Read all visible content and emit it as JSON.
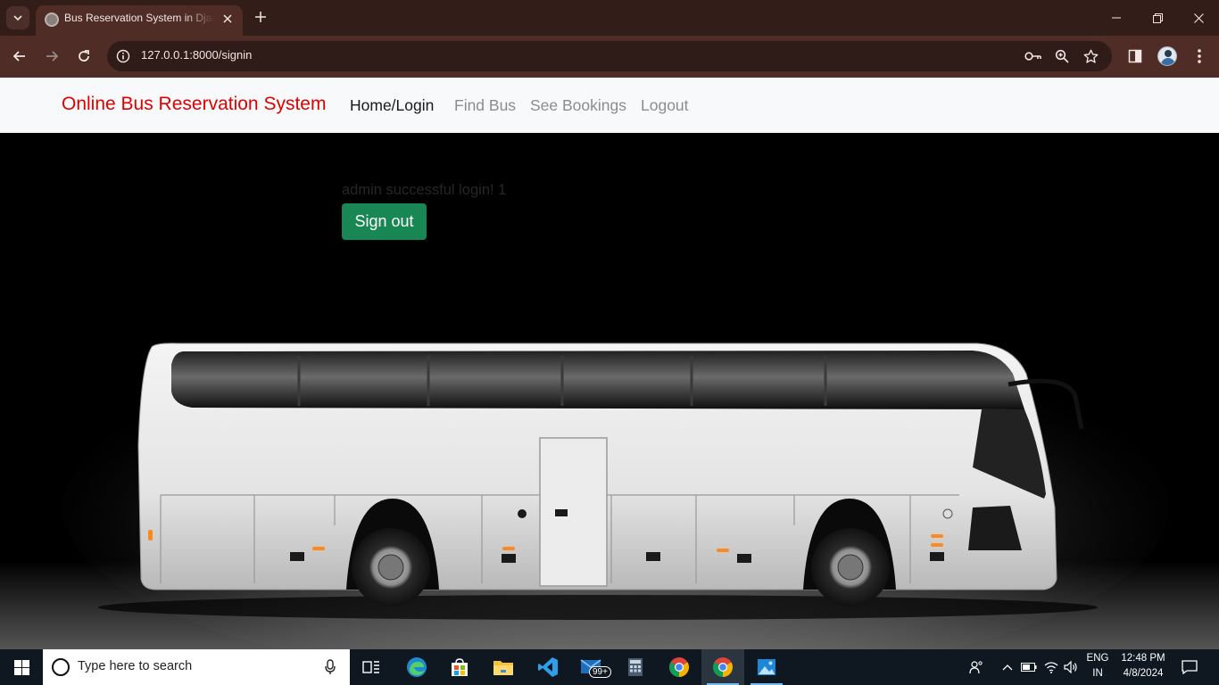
{
  "browser": {
    "tab_title": "Bus Reservation System in Django",
    "url": "127.0.0.1:8000/signin"
  },
  "navbar": {
    "brand": "Online Bus Reservation System",
    "links": [
      "Home/Login",
      "Find Bus",
      "See Bookings",
      "Logout"
    ],
    "active_index": 0
  },
  "content": {
    "message": "admin successful login! 1",
    "signout_label": "Sign out"
  },
  "taskbar": {
    "search_placeholder": "Type here to search",
    "mail_badge": "99+",
    "language": "ENG",
    "region": "IN",
    "time": "12:48 PM",
    "date": "4/8/2024"
  },
  "colors": {
    "brand_red": "#e00000",
    "signout_green": "#198754",
    "chrome_dark": "#321d18",
    "chrome_toolbar": "#4f2c25"
  },
  "icons": [
    "tab-search-icon",
    "favicon-icon",
    "close-icon",
    "plus-icon",
    "minimize-icon",
    "restore-icon",
    "back-icon",
    "forward-icon",
    "reload-icon",
    "info-icon",
    "key-icon",
    "zoom-icon",
    "star-icon",
    "side-panel-icon",
    "menu-icon",
    "windows-icon",
    "mic-icon",
    "task-view-icon",
    "edge-icon",
    "store-icon",
    "explorer-icon",
    "vscode-icon",
    "mail-icon",
    "calculator-icon",
    "chrome-icon",
    "photos-icon",
    "people-icon",
    "chevron-up-icon",
    "battery-icon",
    "wifi-icon",
    "volume-icon",
    "notifications-icon"
  ]
}
